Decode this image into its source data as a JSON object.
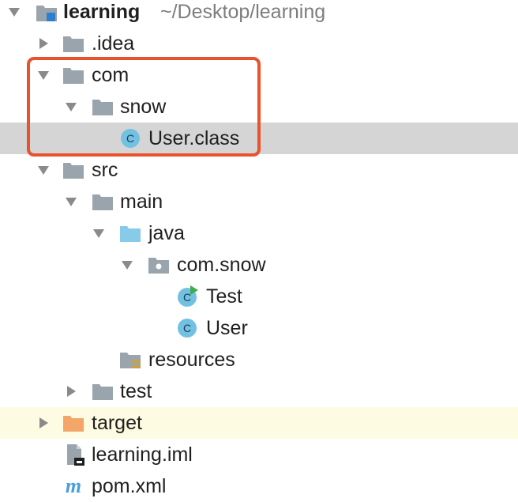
{
  "tree": {
    "root": {
      "label": "learning",
      "path": "~/Desktop/learning",
      "expanded": true,
      "icon": "module-folder-icon"
    },
    "items": [
      {
        "label": ".idea",
        "expanded": false,
        "icon": "folder-icon"
      },
      {
        "label": "com",
        "expanded": true,
        "icon": "folder-icon"
      },
      {
        "label": "snow",
        "expanded": true,
        "icon": "folder-icon"
      },
      {
        "label": "User.class",
        "icon": "class-icon",
        "selected": true
      },
      {
        "label": "src",
        "expanded": true,
        "icon": "folder-icon"
      },
      {
        "label": "main",
        "expanded": true,
        "icon": "folder-icon"
      },
      {
        "label": "java",
        "expanded": true,
        "icon": "source-folder-icon"
      },
      {
        "label": "com.snow",
        "expanded": true,
        "icon": "package-icon"
      },
      {
        "label": "Test",
        "icon": "runnable-class-icon"
      },
      {
        "label": "User",
        "icon": "class-icon"
      },
      {
        "label": "resources",
        "icon": "resources-folder-icon"
      },
      {
        "label": "test",
        "expanded": false,
        "icon": "folder-icon"
      },
      {
        "label": "target",
        "expanded": false,
        "icon": "excluded-folder-icon"
      },
      {
        "label": "learning.iml",
        "icon": "module-file-icon"
      },
      {
        "label": "pom.xml",
        "icon": "maven-icon"
      }
    ]
  },
  "colors": {
    "folder": "#9aa4ad",
    "source_folder": "#87cbe8",
    "excluded_folder": "#f4a56a",
    "class_circle": "#72c1e3",
    "run_marker": "#3fae49",
    "selection": "#d5d5d5",
    "excluded_row": "#fdfbe2",
    "highlight_border": "#e9532c",
    "maven": "#4a9fd9"
  }
}
